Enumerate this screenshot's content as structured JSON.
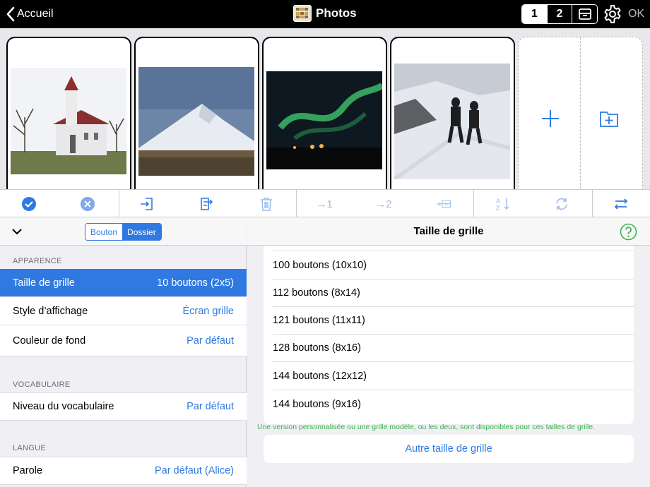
{
  "header": {
    "back_label": "Accueil",
    "title": "Photos",
    "pages": [
      "1",
      "2"
    ],
    "active_page": "1",
    "ok_label": "OK"
  },
  "cards": [
    {
      "name": "church",
      "icon": "photo-church"
    },
    {
      "name": "mountain",
      "icon": "photo-mountain"
    },
    {
      "name": "aurora",
      "icon": "photo-aurora"
    },
    {
      "name": "snow-hikers",
      "icon": "photo-snow-hikers"
    }
  ],
  "toolbar": {
    "icons": [
      "select-all-icon",
      "deselect-icon",
      "import-icon",
      "copy-to-icon",
      "trash-icon",
      "move-to-page-1",
      "move-to-page-2",
      "move-to-drawer",
      "sort-icon",
      "refresh-icon",
      "swap-icon"
    ],
    "move1": "→1",
    "move2": "→2"
  },
  "left": {
    "segment": {
      "button": "Bouton",
      "folder": "Dossier",
      "active": "Dossier"
    },
    "sections": {
      "appearance": "APPARENCE",
      "vocabulary": "VOCABULAIRE",
      "language": "LANGUE"
    },
    "rows": {
      "grid_size": {
        "label": "Taille de grille",
        "value": "10 boutons (2x5)"
      },
      "display_style": {
        "label": "Style d’affichage",
        "value": "Écran grille"
      },
      "background": {
        "label": "Couleur de fond",
        "value": "Par défaut"
      },
      "vocab_level": {
        "label": "Niveau du vocabulaire",
        "value": "Par défaut"
      },
      "speech": {
        "label": "Parole",
        "value": "Par défaut (Alice)"
      }
    }
  },
  "right": {
    "title": "Taille de grille",
    "options": [
      "100 boutons (10x10)",
      "112 boutons (8x14)",
      "121 boutons (11x11)",
      "128 boutons (8x16)",
      "144 boutons (12x12)",
      "144 boutons (9x16)"
    ],
    "note": "Une version personnalisée ou une grille modèle, ou les deux, sont disponibles pour ces tailles de grille.",
    "other_label": "Autre taille de grille"
  },
  "colors": {
    "accent": "#2f79e0",
    "note_green": "#3cb44b",
    "topbar": "#000000"
  }
}
